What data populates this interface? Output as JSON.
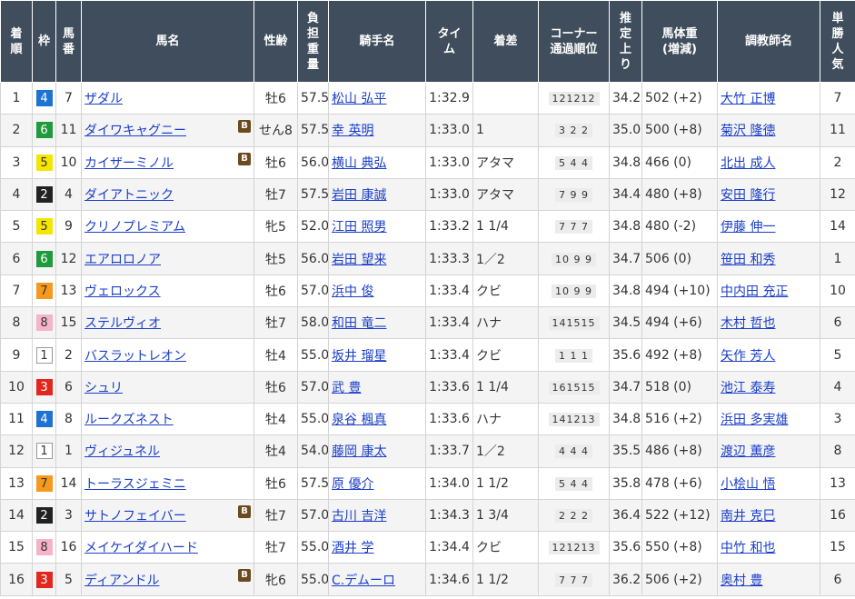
{
  "headers": {
    "rank": [
      "着",
      "順"
    ],
    "waku": [
      "枠"
    ],
    "umaban": [
      "馬",
      "番"
    ],
    "horse": [
      "馬名"
    ],
    "sexage": [
      "性齢"
    ],
    "weight": [
      "負",
      "担",
      "重",
      "量"
    ],
    "jockey": [
      "騎手名"
    ],
    "time": [
      "タイ",
      "ム"
    ],
    "margin": [
      "着差"
    ],
    "corner": [
      "コーナー",
      "通過順位"
    ],
    "last3f": [
      "推",
      "定",
      "上",
      "り"
    ],
    "bodyweight": [
      "馬体重",
      "(増減)"
    ],
    "trainer": [
      "調教師名"
    ],
    "pop": [
      "単",
      "勝",
      "人",
      "気"
    ]
  },
  "waku_colors": {
    "1": {
      "bg": "#ffffff",
      "fg": "#333333",
      "border": "#999999"
    },
    "2": {
      "bg": "#222222",
      "fg": "#ffffff",
      "border": "#222222"
    },
    "3": {
      "bg": "#e2281e",
      "fg": "#ffffff",
      "border": "#e2281e"
    },
    "4": {
      "bg": "#1e72d2",
      "fg": "#ffffff",
      "border": "#1e72d2"
    },
    "5": {
      "bg": "#f5e600",
      "fg": "#333333",
      "border": "#f5e600"
    },
    "6": {
      "bg": "#1f9a3c",
      "fg": "#ffffff",
      "border": "#1f9a3c"
    },
    "7": {
      "bg": "#f59a1e",
      "fg": "#333333",
      "border": "#f59a1e"
    },
    "8": {
      "bg": "#f5b4c8",
      "fg": "#333333",
      "border": "#f5b4c8"
    }
  },
  "blinker_label": "B",
  "rows": [
    {
      "rank": "1",
      "waku": "4",
      "umaban": "7",
      "horse": "ザダル",
      "blinker": false,
      "sexage": "牡6",
      "weight": "57.5",
      "jockey": "松山 弘平",
      "time": "1:32.9",
      "margin": "",
      "corner": "121212",
      "last3f": "34.2",
      "bodyweight": "502 (+2)",
      "trainer": "大竹 正博",
      "pop": "7"
    },
    {
      "rank": "2",
      "waku": "6",
      "umaban": "11",
      "horse": "ダイワキャグニー",
      "blinker": true,
      "sexage": "せん8",
      "weight": "57.5",
      "jockey": "幸 英明",
      "time": "1:33.0",
      "margin": "1",
      "corner": "3 2 2",
      "last3f": "35.0",
      "bodyweight": "500 (+8)",
      "trainer": "菊沢 隆徳",
      "pop": "11"
    },
    {
      "rank": "3",
      "waku": "5",
      "umaban": "10",
      "horse": "カイザーミノル",
      "blinker": true,
      "sexage": "牡6",
      "weight": "56.0",
      "jockey": "横山 典弘",
      "time": "1:33.0",
      "margin": "アタマ",
      "corner": "5 4 4",
      "last3f": "34.8",
      "bodyweight": "466 (0)",
      "trainer": "北出 成人",
      "pop": "2"
    },
    {
      "rank": "4",
      "waku": "2",
      "umaban": "4",
      "horse": "ダイアトニック",
      "blinker": false,
      "sexage": "牡7",
      "weight": "57.5",
      "jockey": "岩田 康誠",
      "time": "1:33.0",
      "margin": "アタマ",
      "corner": "7 9 9",
      "last3f": "34.4",
      "bodyweight": "480 (+8)",
      "trainer": "安田 隆行",
      "pop": "12"
    },
    {
      "rank": "5",
      "waku": "5",
      "umaban": "9",
      "horse": "クリノプレミアム",
      "blinker": false,
      "sexage": "牝5",
      "weight": "52.0",
      "jockey": "江田 照男",
      "time": "1:33.2",
      "margin": "1 1/4",
      "corner": "7 7 7",
      "last3f": "34.8",
      "bodyweight": "480 (-2)",
      "trainer": "伊藤 伸一",
      "pop": "14"
    },
    {
      "rank": "6",
      "waku": "6",
      "umaban": "12",
      "horse": "エアロロノア",
      "blinker": false,
      "sexage": "牡5",
      "weight": "56.0",
      "jockey": "岩田 望来",
      "time": "1:33.3",
      "margin": "1／2",
      "corner": "10 9 9",
      "last3f": "34.7",
      "bodyweight": "506 (0)",
      "trainer": "笹田 和秀",
      "pop": "1"
    },
    {
      "rank": "7",
      "waku": "7",
      "umaban": "13",
      "horse": "ヴェロックス",
      "blinker": false,
      "sexage": "牡6",
      "weight": "57.0",
      "jockey": "浜中 俊",
      "time": "1:33.4",
      "margin": "クビ",
      "corner": "10 9 9",
      "last3f": "34.8",
      "bodyweight": "494 (+10)",
      "trainer": "中内田 充正",
      "pop": "10"
    },
    {
      "rank": "8",
      "waku": "8",
      "umaban": "15",
      "horse": "ステルヴィオ",
      "blinker": false,
      "sexage": "牡7",
      "weight": "58.0",
      "jockey": "和田 竜二",
      "time": "1:33.4",
      "margin": "ハナ",
      "corner": "141515",
      "last3f": "34.5",
      "bodyweight": "494 (+6)",
      "trainer": "木村 哲也",
      "pop": "6"
    },
    {
      "rank": "9",
      "waku": "1",
      "umaban": "2",
      "horse": "バスラットレオン",
      "blinker": false,
      "sexage": "牡4",
      "weight": "55.0",
      "jockey": "坂井 瑠星",
      "time": "1:33.4",
      "margin": "クビ",
      "corner": "1 1 1",
      "last3f": "35.6",
      "bodyweight": "492 (+8)",
      "trainer": "矢作 芳人",
      "pop": "5"
    },
    {
      "rank": "10",
      "waku": "3",
      "umaban": "6",
      "horse": "シュリ",
      "blinker": false,
      "sexage": "牡6",
      "weight": "57.0",
      "jockey": "武 豊",
      "time": "1:33.6",
      "margin": "1 1/4",
      "corner": "161515",
      "last3f": "34.7",
      "bodyweight": "518 (0)",
      "trainer": "池江 泰寿",
      "pop": "4"
    },
    {
      "rank": "11",
      "waku": "4",
      "umaban": "8",
      "horse": "ルークズネスト",
      "blinker": false,
      "sexage": "牡4",
      "weight": "55.0",
      "jockey": "泉谷 楓真",
      "time": "1:33.6",
      "margin": "ハナ",
      "corner": "141213",
      "last3f": "34.8",
      "bodyweight": "516 (+2)",
      "trainer": "浜田 多実雄",
      "pop": "3"
    },
    {
      "rank": "12",
      "waku": "1",
      "umaban": "1",
      "horse": "ヴィジュネル",
      "blinker": false,
      "sexage": "牡4",
      "weight": "54.0",
      "jockey": "藤岡 康太",
      "time": "1:33.7",
      "margin": "1／2",
      "corner": "4 4 4",
      "last3f": "35.5",
      "bodyweight": "486 (+8)",
      "trainer": "渡辺 薫彦",
      "pop": "8"
    },
    {
      "rank": "13",
      "waku": "7",
      "umaban": "14",
      "horse": "トーラスジェミニ",
      "blinker": false,
      "sexage": "牡6",
      "weight": "57.5",
      "jockey": "原 優介",
      "time": "1:34.0",
      "margin": "1 1/2",
      "corner": "5 4 4",
      "last3f": "35.8",
      "bodyweight": "478 (+6)",
      "trainer": "小桧山 悟",
      "pop": "13"
    },
    {
      "rank": "14",
      "waku": "2",
      "umaban": "3",
      "horse": "サトノフェイバー",
      "blinker": true,
      "sexage": "牡7",
      "weight": "57.0",
      "jockey": "古川 吉洋",
      "time": "1:34.3",
      "margin": "1 3/4",
      "corner": "2 2 2",
      "last3f": "36.4",
      "bodyweight": "522 (+12)",
      "trainer": "南井 克巳",
      "pop": "16"
    },
    {
      "rank": "15",
      "waku": "8",
      "umaban": "16",
      "horse": "メイケイダイハード",
      "blinker": false,
      "sexage": "牡7",
      "weight": "55.0",
      "jockey": "酒井 学",
      "time": "1:34.4",
      "margin": "クビ",
      "corner": "121213",
      "last3f": "35.6",
      "bodyweight": "550 (+8)",
      "trainer": "中竹 和也",
      "pop": "15"
    },
    {
      "rank": "16",
      "waku": "3",
      "umaban": "5",
      "horse": "ディアンドル",
      "blinker": true,
      "sexage": "牝6",
      "weight": "55.0",
      "jockey": "C.デムーロ",
      "time": "1:34.6",
      "margin": "1 1/2",
      "corner": "7 7 7",
      "last3f": "36.2",
      "bodyweight": "506 (+2)",
      "trainer": "奥村 豊",
      "pop": "6"
    }
  ]
}
